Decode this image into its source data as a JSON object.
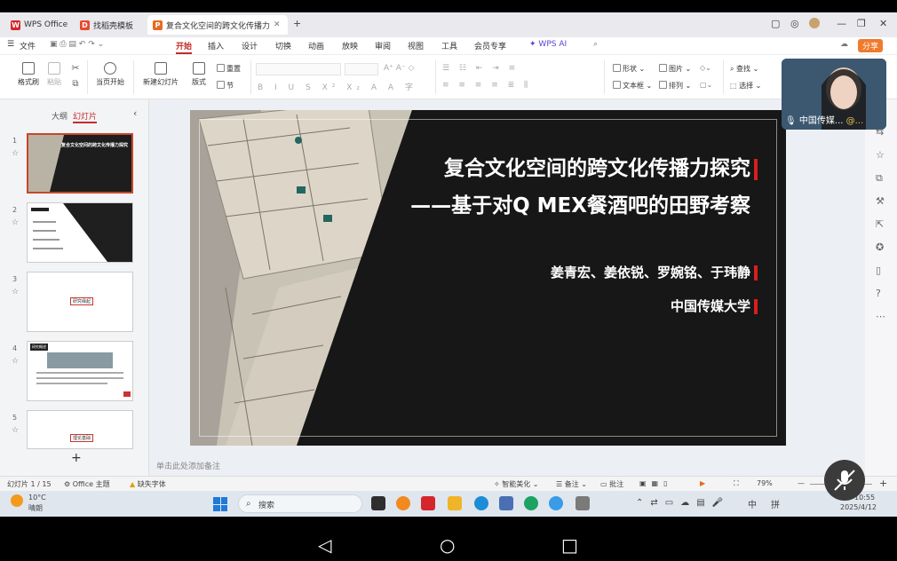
{
  "tabs": [
    {
      "label": "WPS Office",
      "icon": "W"
    },
    {
      "label": "找稻壳模板",
      "icon": "D"
    },
    {
      "label": "复合文化空间的跨文化传播力",
      "icon": "P"
    }
  ],
  "menu": {
    "file": "文件",
    "items": [
      "开始",
      "插入",
      "设计",
      "切换",
      "动画",
      "放映",
      "审阅",
      "视图",
      "工具",
      "会员专享"
    ],
    "wps_ai": "WPS AI",
    "share": "分享"
  },
  "ribbon": {
    "format_painter": "格式刷",
    "paste": "粘贴",
    "cut_label": "",
    "from_current": "当页开始",
    "new_slide": "新建幻灯片",
    "layout": "版式",
    "section": "节",
    "reset": "重置",
    "shape": "形状",
    "picture": "图片",
    "textbox": "文本框",
    "arrange": "排列",
    "find": "查找",
    "select": "选择"
  },
  "panel": {
    "tab_outline": "大纲",
    "tab_slides": "幻灯片",
    "add": "+"
  },
  "thumbs": [
    {
      "num": "1",
      "text": "复合文化空间的跨文化传播力探究"
    },
    {
      "num": "2",
      "text": "目录"
    },
    {
      "num": "3",
      "text": "研究缘起"
    },
    {
      "num": "4",
      "text": "研究概述"
    },
    {
      "num": "5",
      "text": "理论基础"
    }
  ],
  "slide": {
    "title_line1": "复合文化空间的跨文化传播力探究",
    "title_line2": "——基于对Q MEX餐酒吧的田野考察",
    "authors": "姜青宏、姜依锐、罗婉铭、于玮静",
    "university": "中国传媒大学"
  },
  "notes_placeholder": "单击此处添加备注",
  "video": {
    "caption": "中国传媒..."
  },
  "status": {
    "slide_count": "幻灯片 1 / 15",
    "theme": "Office 主题",
    "missing_font": "缺失字体",
    "beautify": "智能美化",
    "notes": "备注",
    "comments": "批注",
    "zoom": "79%"
  },
  "taskbar": {
    "weather_temp": "10°C",
    "weather_desc": "晴朗",
    "search": "搜索",
    "time": "10:55",
    "date": "2025/4/12",
    "ime": "中",
    "ime2": "拼"
  }
}
